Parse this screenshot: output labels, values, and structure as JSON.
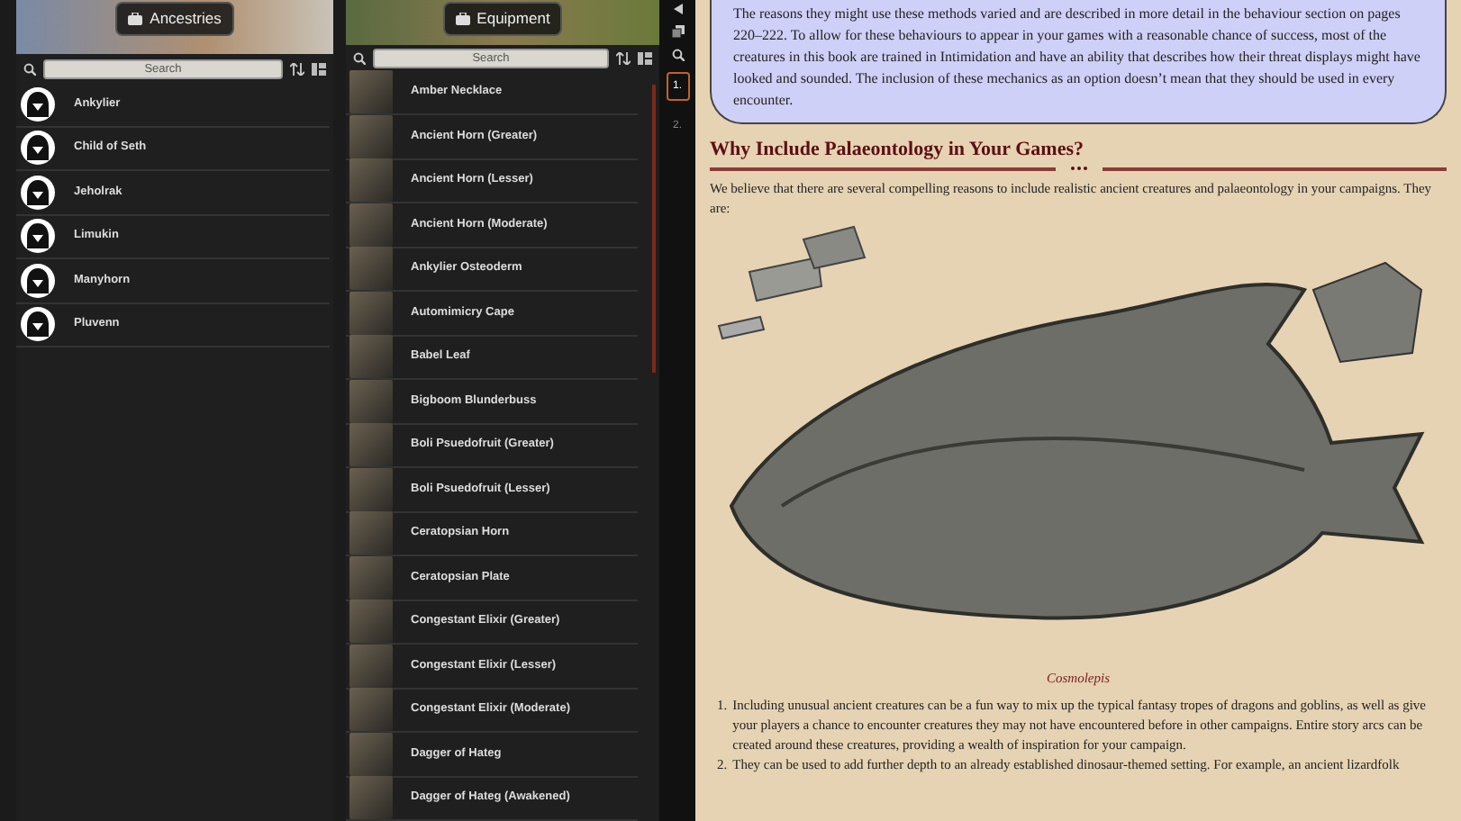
{
  "ancestries": {
    "title": "Ancestries",
    "search": {
      "placeholder": "Search"
    },
    "items": [
      {
        "name": "Ankylier"
      },
      {
        "name": "Child of Seth"
      },
      {
        "name": "Jeholrak"
      },
      {
        "name": "Limukin"
      },
      {
        "name": "Manyhorn"
      },
      {
        "name": "Pluvenn"
      }
    ]
  },
  "equipment": {
    "title": "Equipment",
    "search": {
      "placeholder": "Search"
    },
    "items": [
      {
        "name": "Amber Necklace"
      },
      {
        "name": "Ancient Horn (Greater)"
      },
      {
        "name": "Ancient Horn (Lesser)"
      },
      {
        "name": "Ancient Horn (Moderate)"
      },
      {
        "name": "Ankylier Osteoderm"
      },
      {
        "name": "Automimicry Cape"
      },
      {
        "name": "Babel Leaf"
      },
      {
        "name": "Bigboom Blunderbuss"
      },
      {
        "name": "Boli Psuedofruit (Greater)"
      },
      {
        "name": "Boli Psuedofruit (Lesser)"
      },
      {
        "name": "Ceratopsian Horn"
      },
      {
        "name": "Ceratopsian Plate"
      },
      {
        "name": "Congestant Elixir (Greater)"
      },
      {
        "name": "Congestant Elixir (Lesser)"
      },
      {
        "name": "Congestant Elixir (Moderate)"
      },
      {
        "name": "Dagger of Hateg"
      },
      {
        "name": "Dagger of Hateg (Awakened)"
      }
    ]
  },
  "pages": [
    {
      "label": "1.",
      "selected": true
    },
    {
      "label": "2.",
      "selected": false
    }
  ],
  "journal": {
    "callout": "The reasons they might use these methods varied and are described in more detail in the behaviour section on pages 220–222. To allow for these behaviours to appear in your games with a reasonable chance of success, most of the creatures in this book are trained in Intimidation and have an ability that describes how their threat displays might have looked and sounded. The inclusion of these mechanics as an option doesn’t mean that they should be used in every encounter.",
    "heading": "Why Include Palaeontology in Your Games?",
    "intro": "We believe that there are several compelling reasons to include realistic ancient creatures and palaeontology in your campaigns. They are:",
    "caption": "Cosmolepis",
    "list": [
      {
        "marker": "1.",
        "text": "Including unusual ancient creatures can be a fun way to mix up the typical fantasy tropes of dragons and goblins, as well as give your players a chance to encounter creatures they may not have encountered before in other campaigns. Entire story arcs can be created around these creatures, providing a wealth of inspiration for your campaign."
      },
      {
        "marker": "2.",
        "text": "They can be used to add further depth to an already established dinosaur-themed setting. For example, an ancient lizardfolk"
      }
    ]
  }
}
